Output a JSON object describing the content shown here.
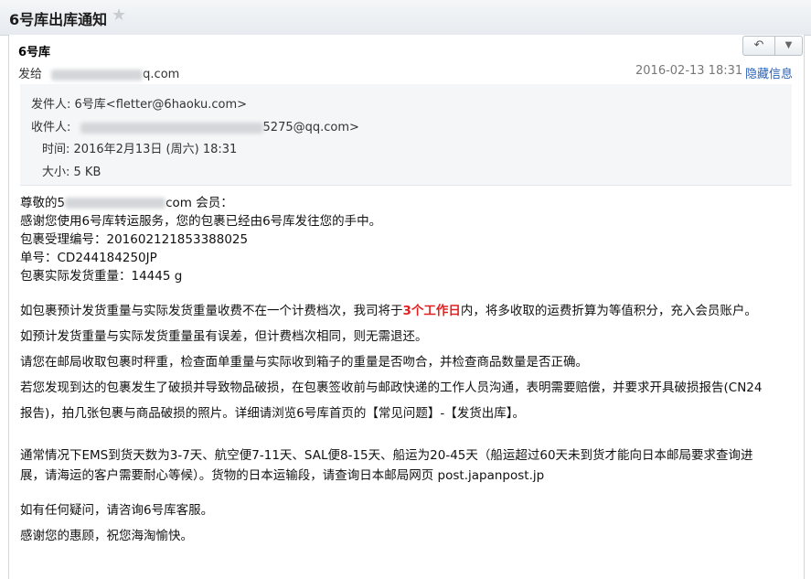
{
  "header": {
    "title": "6号库出库通知",
    "star_icon": "star-icon"
  },
  "toolbar": {
    "reply_icon": "reply-icon",
    "more_icon": "chevron-down-icon"
  },
  "message": {
    "sender_name": "6号库",
    "sendto_prefix": "发给",
    "sendto_suffix": "q.com",
    "date": "2016-02-13 18:31",
    "hide_info": "隐藏信息"
  },
  "meta": {
    "from_label": "发件人:",
    "from_value": "6号库<fletter@6haoku.com>",
    "to_label": "收件人:",
    "to_value_suffix": "5275@qq.com>",
    "time_label": "时间:",
    "time_value": "2016年2月13日 (周六) 18:31",
    "size_label": "大小:",
    "size_value": "5 KB"
  },
  "body": {
    "greeting_prefix": "尊敬的5",
    "greeting_suffix": "com 会员：",
    "p1": "感谢您使用6号库转运服务，您的包裹已经由6号库发往您的手中。",
    "p2": "包裹受理编号：201602121853388025",
    "p3": "单号：CD244184250JP",
    "p4": "包裹实际发货重量：14445 g",
    "p5a": "如包裹预计发货重量与实际发货重量收费不在一个计费档次，我司将于",
    "p5b": "3个工作日",
    "p5c": "内，将多收取的运费折算为等值积分，充入会员账户。",
    "p6": "如预计发货重量与实际发货重量虽有误差，但计费档次相同，则无需退还。",
    "p7": "请您在邮局收取包裹时秤重，检查面单重量与实际收到箱子的重量是否吻合，并检查商品数量是否正确。",
    "p8": "若您发现到达的包裹发生了破损并导致物品破损，在包裹签收前与邮政快递的工作人员沟通，表明需要赔偿，并要求开具破损报告(CN24",
    "p9": "报告)，拍几张包裹与商品破损的照片。详细请浏览6号库首页的【常见问题】-【发货出库】。",
    "p10": "通常情况下EMS到货天数为3-7天、航空便7-11天、SAL便8-15天、船运为20-45天（船运超过60天未到货才能向日本邮局要求查询进",
    "p11": "展，请海运的客户需要耐心等候）。货物的日本运输段，请查询日本邮局网页 post.japanpost.jp",
    "p12": "如有任何疑问，请咨询6号库客服。",
    "p13": "感谢您的惠顾，祝您海淘愉快。"
  }
}
